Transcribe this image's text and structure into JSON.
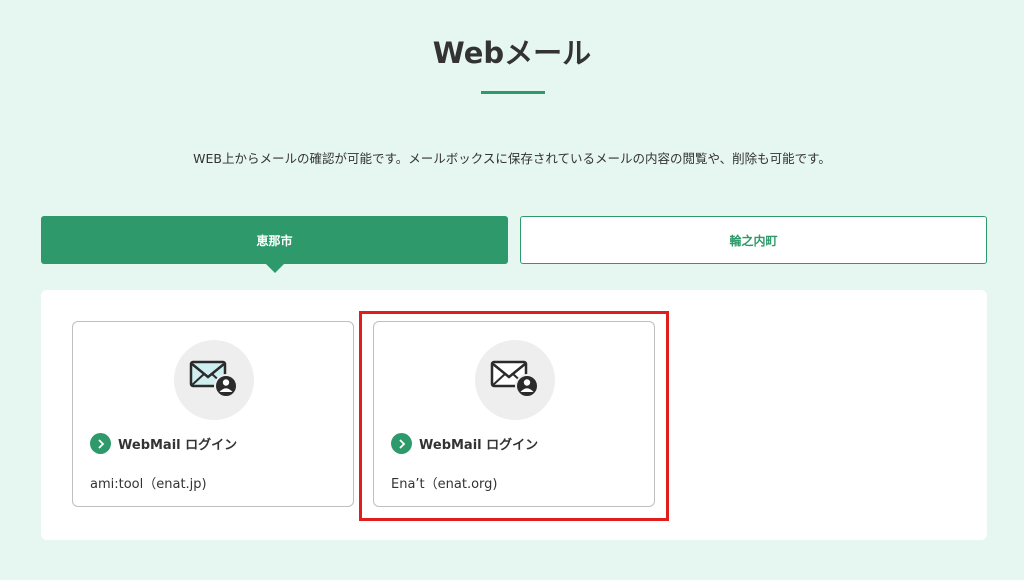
{
  "page": {
    "title": "Webメール",
    "description": "WEB上からメールの確認が可能です。メールボックスに保存されているメールの内容の閲覧や、削除も可能です。"
  },
  "tabs": [
    {
      "label": "恵那市",
      "active": true
    },
    {
      "label": "輪之内町",
      "active": false
    }
  ],
  "cards": [
    {
      "login_label": "WebMail ログイン",
      "service": "ami:tool（enat.jp)",
      "icon": "mail-user-icon",
      "icon_variant": "light-blue"
    },
    {
      "login_label": "WebMail ログイン",
      "service": "Ena’t（enat.org)",
      "icon": "mail-user-icon",
      "icon_variant": "white"
    }
  ],
  "colors": {
    "background": "#e6f6f0",
    "accent": "#2e9a6b",
    "highlight": "#e01e1e",
    "text": "#333333"
  }
}
